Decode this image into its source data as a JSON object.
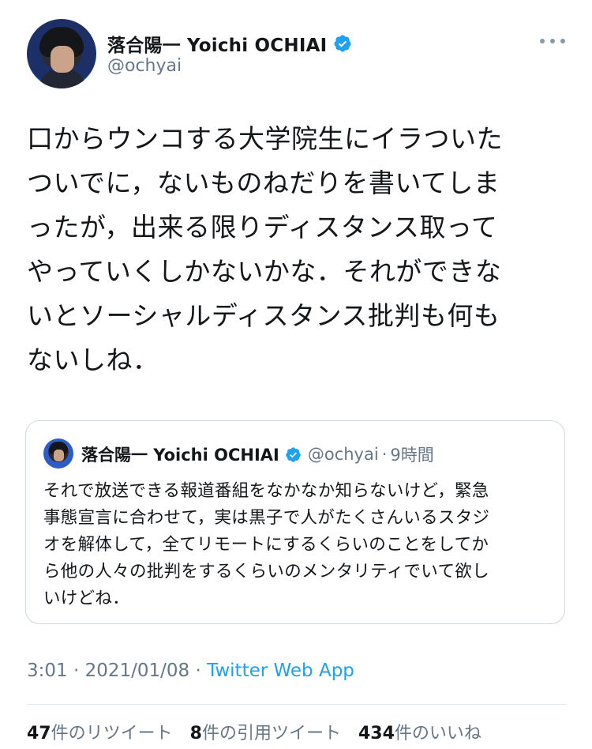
{
  "author": {
    "display_name": "落合陽一 Yoichi OCHIAI",
    "handle": "@ochyai"
  },
  "tweet": {
    "lines": [
      "口からウンコする大学院生にイラついた",
      "ついでに，ないものねだりを書いてしま",
      "ったが，出来る限りディスタンス取って",
      "やっていくしかないかな．それができな",
      "いとソーシャルディスタンス批判も何も",
      "ないしね．"
    ]
  },
  "quoted_tweet": {
    "display_name": "落合陽一 Yoichi OCHIAI",
    "handle": "@ochyai",
    "separator": "·",
    "time": "9時間",
    "lines": [
      "それで放送できる報道番組をなかなか知らないけど，緊急",
      "事態宣言に合わせて，実は黒子で人がたくさんいるスタジ",
      "オを解体して，全てリモートにするくらいのことをしてか",
      "ら他の人々の批判をするくらいのメンタリティでいて欲し",
      "いけどね．"
    ]
  },
  "meta": {
    "time": "3:01",
    "sep1": " · ",
    "date": "2021/01/08",
    "sep2": " · ",
    "source": "Twitter Web App"
  },
  "stats": {
    "retweets_count": "47",
    "retweets_label": "件のリツイート",
    "quotes_count": "8",
    "quotes_label": "件の引用ツイート",
    "likes_count": "434",
    "likes_label": "件のいいね"
  },
  "colors": {
    "verified": "#1da1f2",
    "link": "#1da1f2",
    "secondary_text": "#657786"
  },
  "icons": {
    "verified": "verified-badge-icon",
    "more": "more-horizontal-icon"
  }
}
